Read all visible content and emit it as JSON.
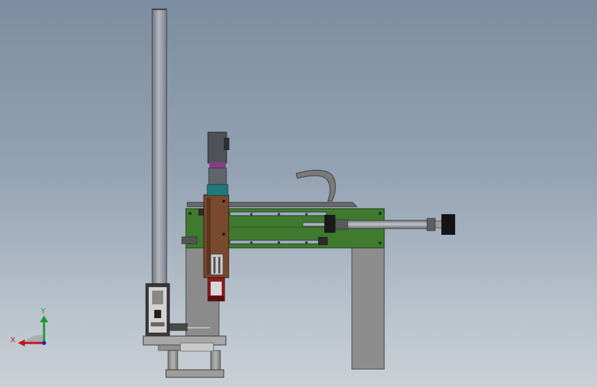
{
  "view": {
    "background_top": "#7b8da0",
    "background_bottom": "#c9d0d6"
  },
  "triad": {
    "x_label": "X",
    "y_label": "Y",
    "x_color": "#c0141c",
    "y_color": "#1a9a2a",
    "z_color": "#1c2c9a"
  },
  "model": {
    "frame_color": "#3f7a2e",
    "carriage_color": "#7a4a2e",
    "column_color": "#8a8f98",
    "post_color": "#9a9a9a"
  }
}
